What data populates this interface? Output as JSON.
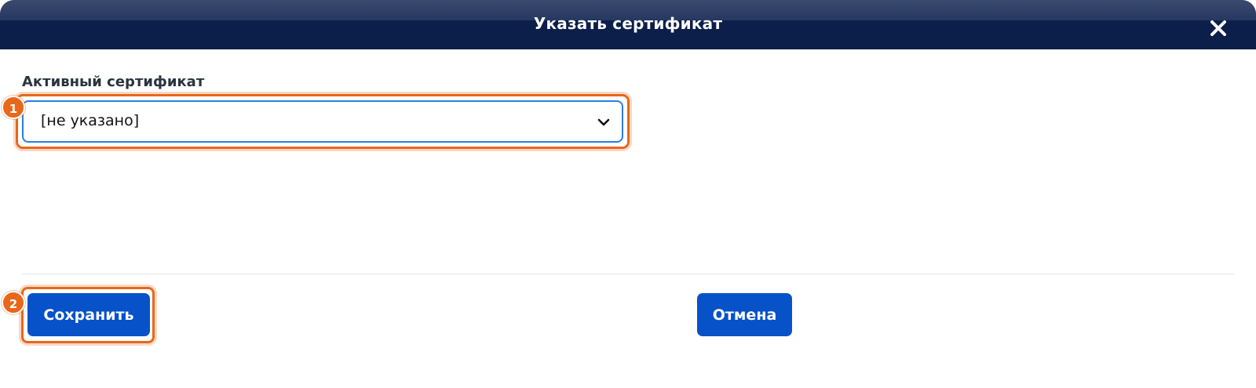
{
  "dialog": {
    "title": "Указать сертификат",
    "close_icon": "close-icon"
  },
  "form": {
    "certificate_label": "Активный сертификат",
    "certificate_value": "[не указано]"
  },
  "actions": {
    "save_label": "Сохранить",
    "cancel_label": "Отмена"
  },
  "annotations": {
    "step1": "1",
    "step2": "2"
  },
  "colors": {
    "header_bg": "#0c1f4a",
    "primary_button": "#0752c9",
    "highlight": "#e8671b",
    "focus_border": "#2a7de1"
  }
}
